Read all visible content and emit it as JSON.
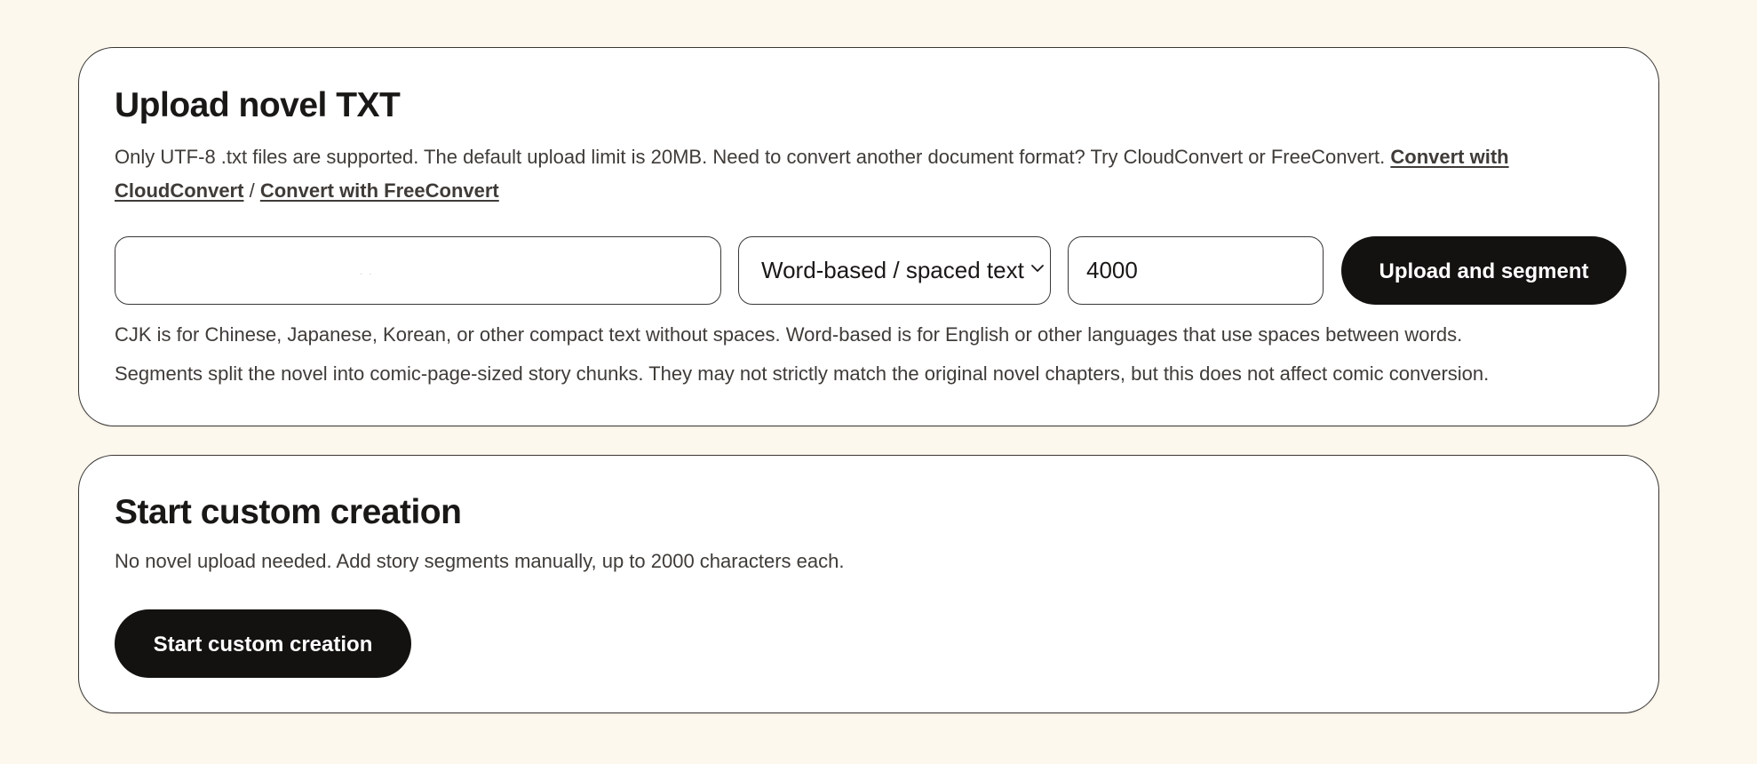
{
  "upload_card": {
    "title": "Upload novel TXT",
    "description": "Only UTF-8 .txt files are supported. The default upload limit is 20MB. Need to convert another document format? Try CloudConvert or FreeConvert.",
    "link_cloudconvert": "Convert with CloudConvert",
    "link_separator": "/",
    "link_freeconvert": "Convert with FreeConvert",
    "file_input_value": "· ·",
    "mode_select": {
      "selected": "Word-based / spaced text"
    },
    "segment_size_value": "4000",
    "upload_button_label": "Upload and segment",
    "hint_cjk": "CJK is for Chinese, Japanese, Korean, or other compact text without spaces. Word-based is for English or other languages that use spaces between words.",
    "hint_segments": "Segments split the novel into comic-page-sized story chunks. They may not strictly match the original novel chapters, but this does not affect comic conversion."
  },
  "custom_card": {
    "title": "Start custom creation",
    "description": "No novel upload needed. Add story segments manually, up to 2000 characters each.",
    "button_label": "Start custom creation"
  },
  "colors": {
    "page_background": "#fdf8ee",
    "card_background": "#ffffff",
    "button_background": "#141210",
    "button_text": "#ffffff"
  },
  "icons": {
    "select_chevron": "chevron-down-icon"
  }
}
